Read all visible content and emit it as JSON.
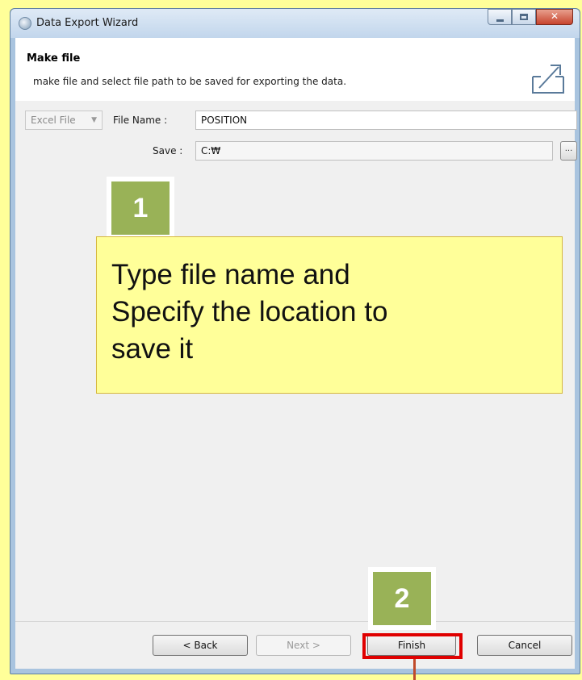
{
  "window": {
    "title": "Data Export Wizard"
  },
  "header": {
    "title": "Make file",
    "description": "make file and select file path to be saved for exporting the data."
  },
  "form": {
    "file_type": "Excel File",
    "file_name_label": "File Name :",
    "file_name_value": "POSITION",
    "save_label": "Save :",
    "save_value": "C:₩",
    "browse_label": "..."
  },
  "annotations": {
    "step1": "1",
    "callout_line1": "Type file name and",
    "callout_line2": "Specify the location to",
    "callout_line3": "save it",
    "step2": "2"
  },
  "footer": {
    "back": "< Back",
    "next": "Next >",
    "finish": "Finish",
    "cancel": "Cancel"
  },
  "colors": {
    "callout_bg": "#ffff99",
    "badge_green": "#99b257",
    "highlight_red": "#e00000"
  }
}
